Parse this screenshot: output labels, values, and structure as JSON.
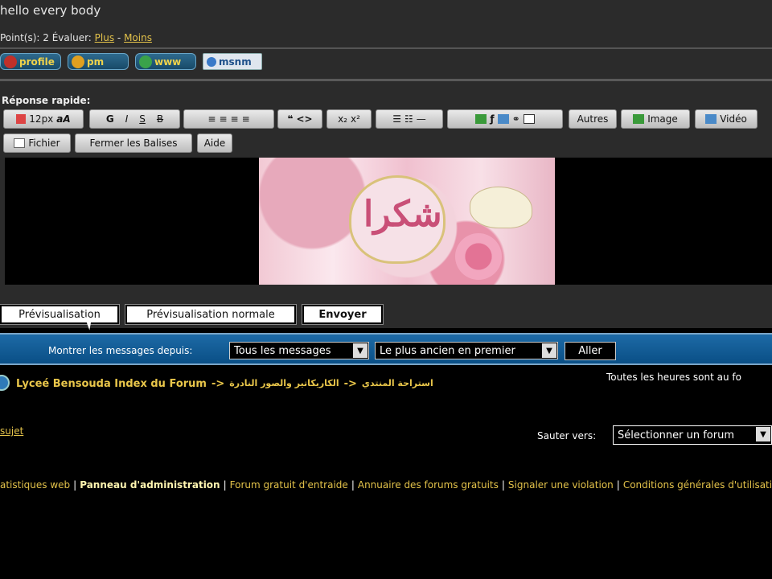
{
  "post": {
    "text": "hello every body",
    "points_label": "Point(s): 2  Évaluer: ",
    "plus": "Plus",
    "dash": " - ",
    "moins": "Moins",
    "buttons": [
      "profile",
      "pm",
      "www",
      "msnm"
    ]
  },
  "reply": {
    "title": "Réponse rapide:",
    "font_size": "12px",
    "bold": "G",
    "italic": "I",
    "underline": "S",
    "strike": "B",
    "autres": "Autres",
    "image": "Image",
    "video": "Vidéo",
    "fichier": "Fichier",
    "fermer": "Fermer les Balises",
    "aide": "Aide",
    "sticker_text": "شكرا",
    "preview": "Prévisualisation",
    "preview_normal": "Prévisualisation normale",
    "send": "Envoyer"
  },
  "filter": {
    "label": "Montrer les messages depuis:",
    "since": "Tous les messages",
    "order": "Le plus ancien en premier",
    "go": "Aller"
  },
  "breadcrumb": {
    "index": "Lyceé Bensouda Index du Forum",
    "arrow1": "->",
    "cat1": "استراحة المنتدي",
    "arrow2": "->",
    "cat2": "الكاريكاتير والصور النادرة"
  },
  "hours": "Toutes les heures sont au fo",
  "sujet": "sujet",
  "jump": {
    "label": "Sauter vers:",
    "value": "Sélectionner un forum"
  },
  "footer": {
    "stats": "atistiques web",
    "admin": "Panneau d'administration",
    "forum": "Forum gratuit d'entraide",
    "annuaire": "Annuaire des forums gratuits",
    "signaler": "Signaler une violation",
    "conditions": "Conditions générales d'utilisation"
  },
  "colors": {
    "link": "#e3c24a",
    "bar": "#0a4f86",
    "panel": "#2b2b2b"
  }
}
